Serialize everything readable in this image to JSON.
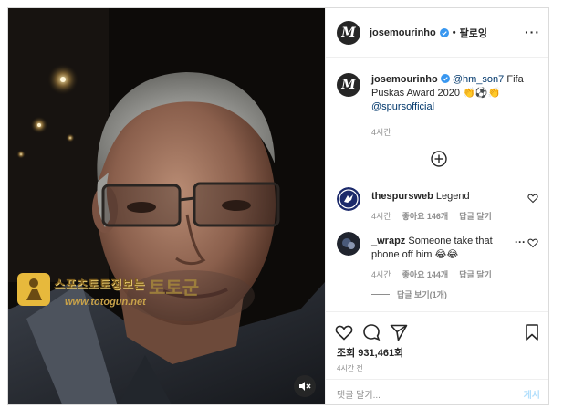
{
  "post": {
    "username": "josemourinho",
    "follow_label": "팔로잉",
    "separator": "•",
    "more_label": "···",
    "avatar_initial": "M",
    "caption": {
      "mention1": "@hm_son7",
      "text_mid": "Fifa Puskas Award 2020 👏⚽👏",
      "mention2": "@spursofficial",
      "time": "4시간"
    },
    "comments": [
      {
        "username": "thespursweb",
        "text": "Legend",
        "time": "4시간",
        "likes": "좋아요 146개",
        "reply": "답글 달기"
      },
      {
        "username": "_wrapz",
        "text": "Someone take that phone off him 😂😂",
        "time": "4시간",
        "likes": "좋아요 144개",
        "reply": "답글 달기",
        "more": "···"
      }
    ],
    "view_replies": "답글 보기(1개)",
    "views": "조회 931,461회",
    "posted": "4시간 전",
    "add_comment_placeholder": "댓글 달기...",
    "post_label": "게시"
  },
  "watermark": {
    "title": "스포츠토토정보는",
    "url": "www.totogun.net",
    "mark": "토토군"
  },
  "colors": {
    "verified": "#3897f0",
    "link": "#00376b",
    "muted": "#8e8e8e",
    "post_disabled": "#b2dffc"
  },
  "icons": {
    "like": "heart-icon",
    "comment": "comment-bubble-icon",
    "share": "paper-plane-icon",
    "save": "bookmark-icon",
    "mute": "speaker-muted-icon",
    "load_more": "plus-circle-icon"
  }
}
